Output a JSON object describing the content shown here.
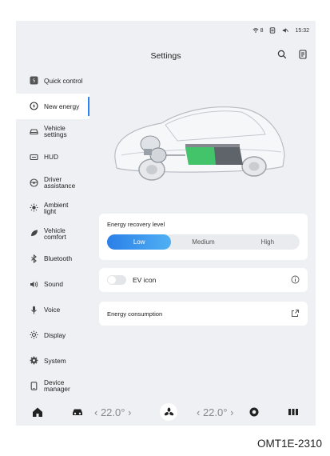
{
  "status": {
    "wifi": "8",
    "time": "15:32"
  },
  "header": {
    "title": "Settings"
  },
  "sidebar": {
    "items": [
      {
        "label": "Quick control"
      },
      {
        "label": "New energy"
      },
      {
        "label": "Vehicle\nsettings"
      },
      {
        "label": "HUD"
      },
      {
        "label": "Driver\nassistance"
      },
      {
        "label": "Ambient\nlight"
      },
      {
        "label": "Vehicle\ncomfort"
      },
      {
        "label": "Bluetooth"
      },
      {
        "label": "Sound"
      },
      {
        "label": "Voice"
      },
      {
        "label": "Display"
      },
      {
        "label": "System"
      },
      {
        "label": "Device\nmanager"
      }
    ]
  },
  "energy_recovery": {
    "label": "Energy recovery level",
    "options": [
      "Low",
      "Medium",
      "High"
    ],
    "selected": "Low"
  },
  "ev_icon": {
    "label": "EV icon",
    "enabled": false
  },
  "energy_consumption": {
    "label": "Energy consumption"
  },
  "dock": {
    "temp_left": "22.0°",
    "temp_right": "22.0°"
  },
  "caption": "OMT1E-2310",
  "colors": {
    "accent": "#2d84f0",
    "battery_green": "#43c36a"
  }
}
